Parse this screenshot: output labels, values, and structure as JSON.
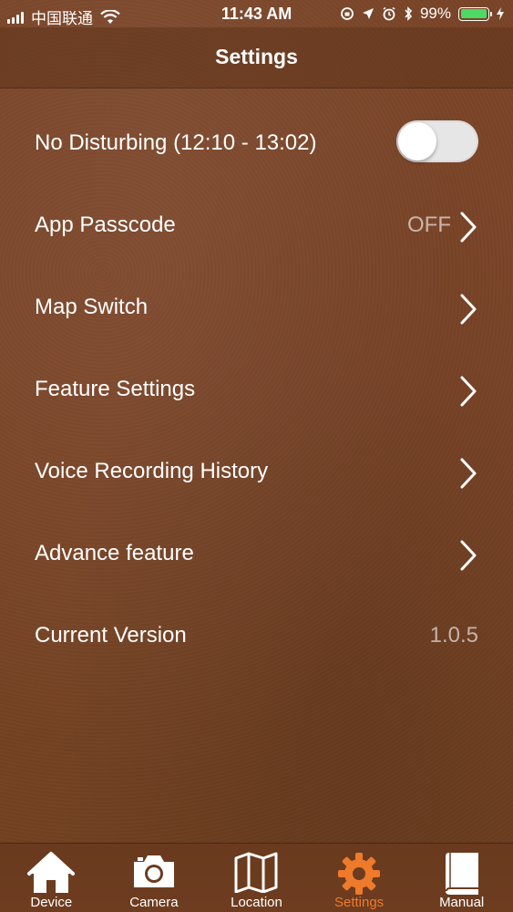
{
  "status_bar": {
    "carrier": "中国联通",
    "time": "11:43 AM",
    "battery_percent": "99%",
    "battery_level": 0.99,
    "battery_color": "#4cd964"
  },
  "nav": {
    "title": "Settings"
  },
  "settings": {
    "rows": [
      {
        "label": "No Disturbing (12:10 - 13:02)",
        "control": "toggle",
        "toggle_on": false
      },
      {
        "label": "App Passcode",
        "value": "OFF",
        "control": "chevron"
      },
      {
        "label": "Map Switch",
        "control": "chevron"
      },
      {
        "label": "Feature Settings",
        "control": "chevron"
      },
      {
        "label": "Voice Recording History",
        "control": "chevron"
      },
      {
        "label": "Advance feature",
        "control": "chevron"
      },
      {
        "label": "Current Version",
        "value": "1.0.5"
      }
    ]
  },
  "tab_bar": {
    "active_color": "#ee7a2c",
    "tabs": [
      {
        "label": "Device",
        "icon": "home-icon"
      },
      {
        "label": "Camera",
        "icon": "camera-icon"
      },
      {
        "label": "Location",
        "icon": "map-icon"
      },
      {
        "label": "Settings",
        "icon": "gear-icon",
        "active": true
      },
      {
        "label": "Manual",
        "icon": "book-icon"
      }
    ]
  }
}
